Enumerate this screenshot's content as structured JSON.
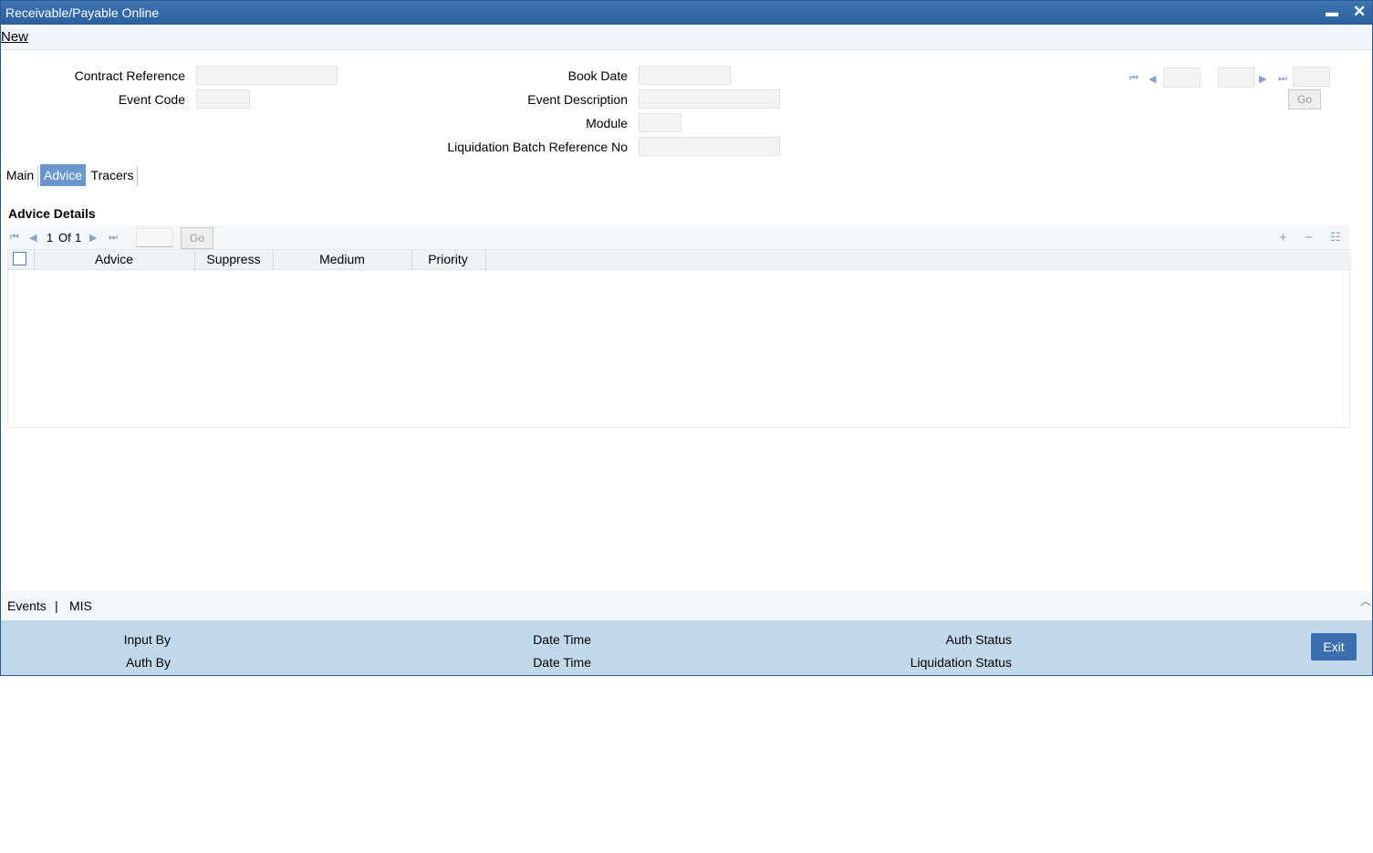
{
  "window": {
    "title": "Receivable/Payable Online",
    "minimize_glyph": "▬",
    "close_glyph": "✕"
  },
  "toolbar": {
    "new_label": "New"
  },
  "form": {
    "contract_reference_label": "Contract Reference",
    "event_code_label": "Event Code",
    "book_date_label": "Book Date",
    "event_description_label": "Event Description",
    "module_label": "Module",
    "liquidation_batch_label": "Liquidation Batch Reference No",
    "contract_reference_value": "",
    "event_code_value": "",
    "book_date_value": "",
    "event_description_value": "",
    "module_value": "",
    "liquidation_batch_value": ""
  },
  "pager": {
    "go_label": "Go"
  },
  "tabs": [
    {
      "label": "Main"
    },
    {
      "label": "Advice",
      "active": true
    },
    {
      "label": "Tracers"
    }
  ],
  "advice": {
    "section_title": "Advice Details",
    "page_current": "1",
    "page_of": "Of",
    "page_total": "1",
    "go_label": "Go",
    "columns": [
      "Advice",
      "Suppress",
      "Medium",
      "Priority"
    ],
    "rows": []
  },
  "links": {
    "events": "Events",
    "separator": "|",
    "mis": "MIS"
  },
  "footer": {
    "input_by": "Input By",
    "auth_by": "Auth By",
    "date_time_1": "Date Time",
    "date_time_2": "Date Time",
    "auth_status": "Auth Status",
    "liquidation_status": "Liquidation Status",
    "exit_label": "Exit"
  },
  "colors": {
    "title_bar": "#2b5f9e",
    "active_tab": "#6b97cf",
    "footer_bg": "#c2d9ec",
    "exit_button": "#3b6fb0"
  }
}
